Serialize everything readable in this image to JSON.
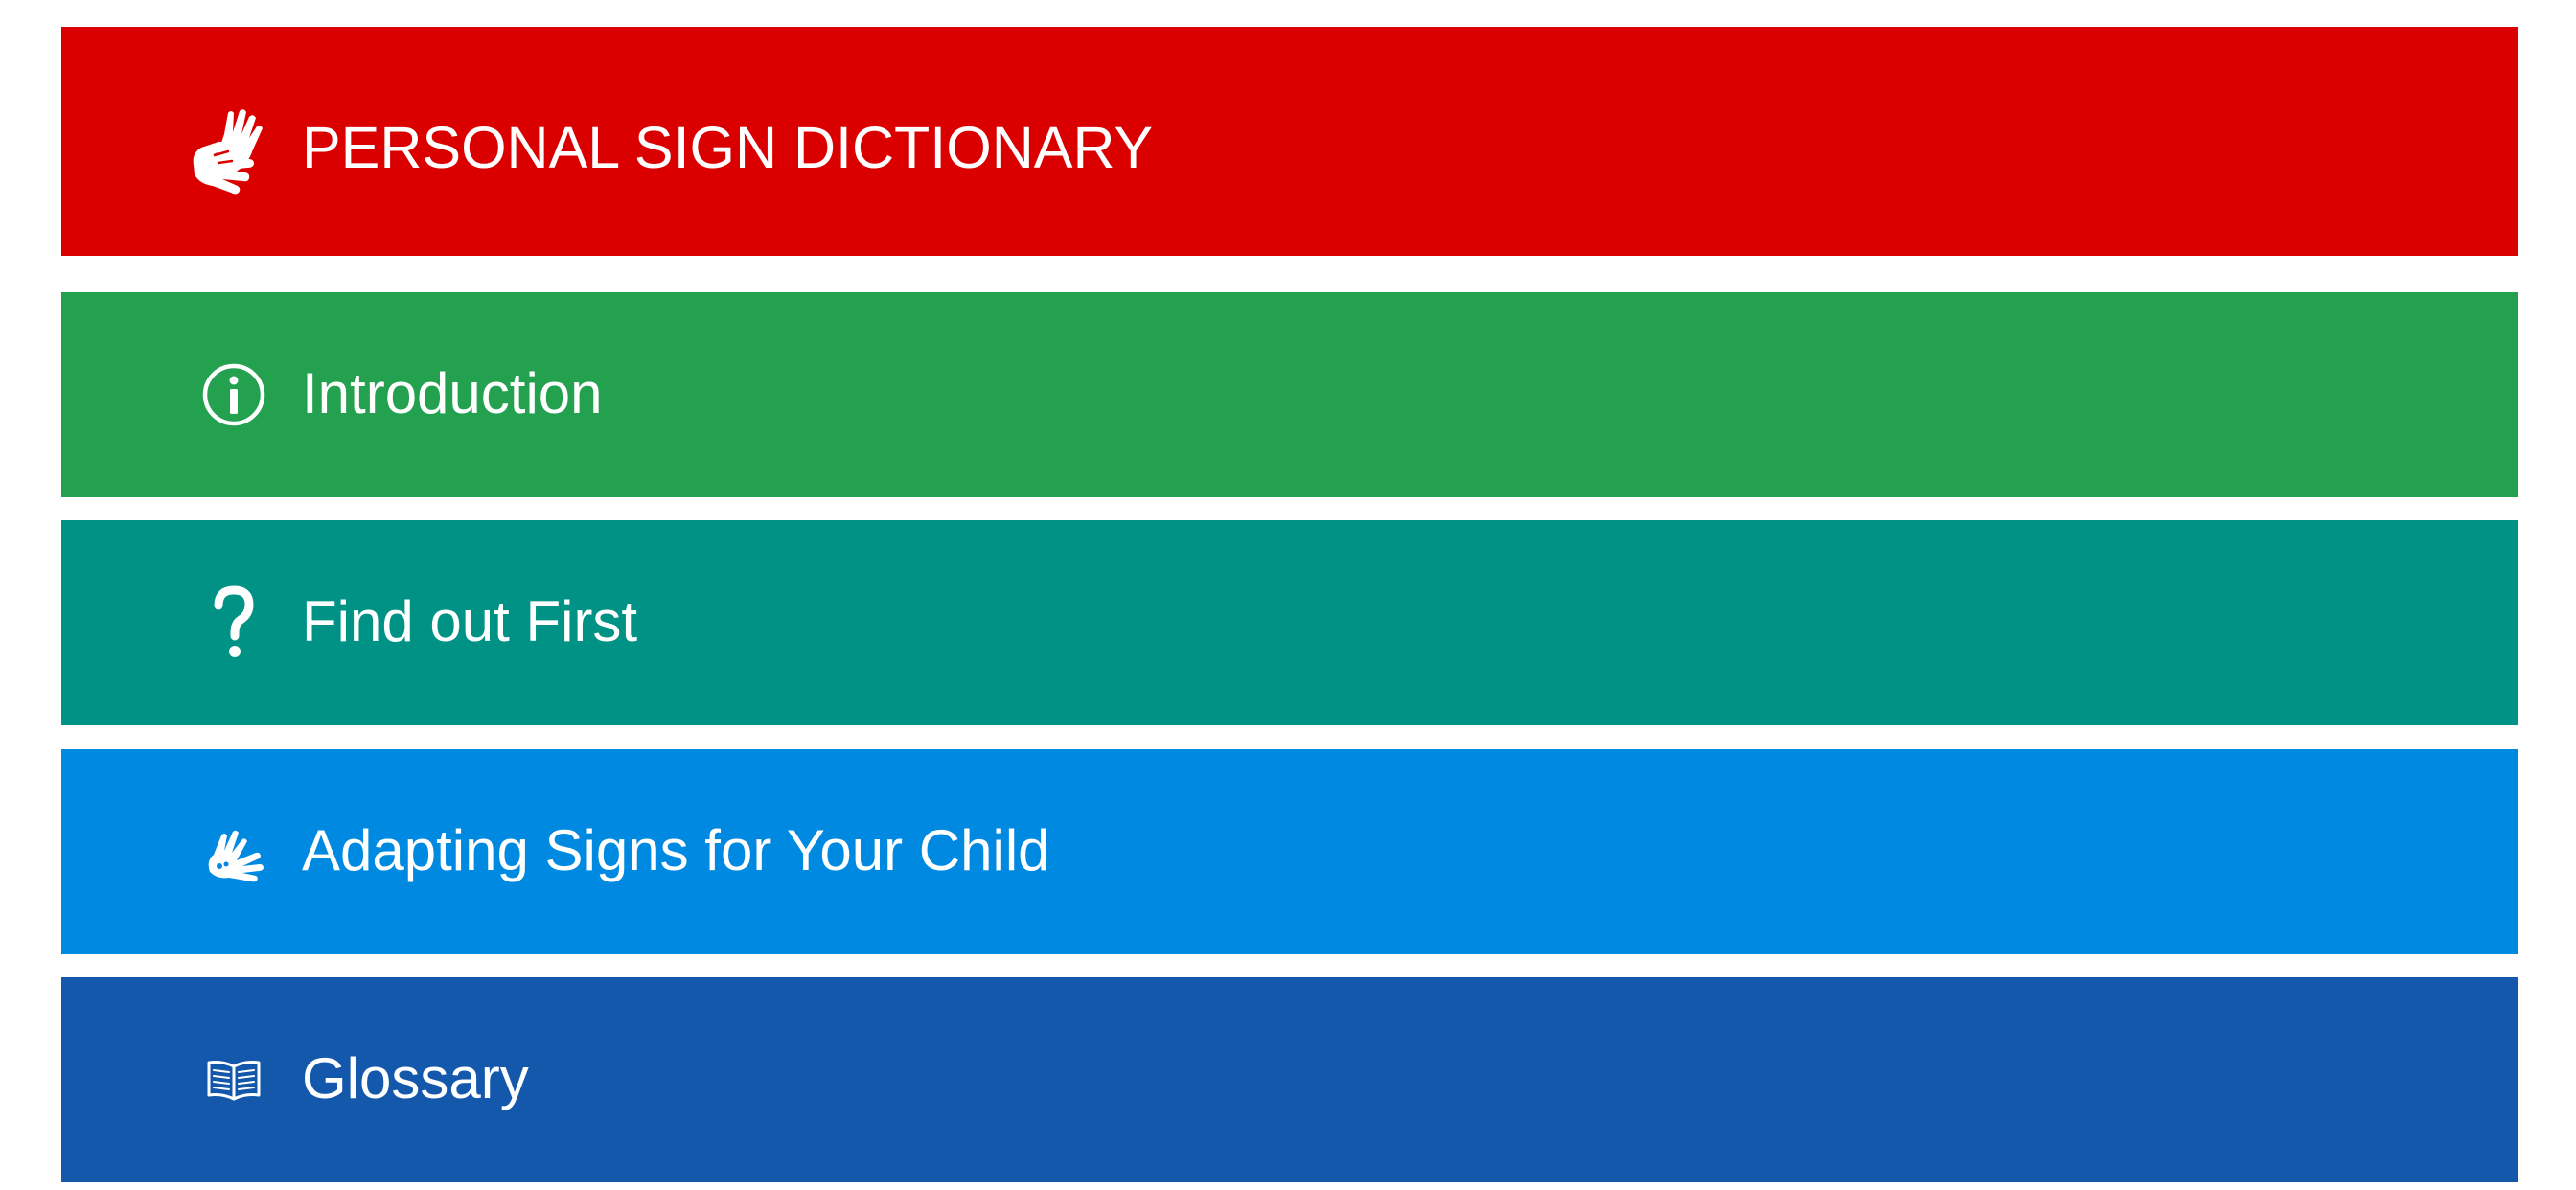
{
  "colors": {
    "header": "#db0000",
    "introduction": "#23a14e",
    "find_out_first": "#009285",
    "adapting_signs": "#0089e0",
    "glossary": "#1358ab"
  },
  "header": {
    "title": "PERSONAL SIGN DICTIONARY",
    "icon": "signing-hands-icon"
  },
  "menu": {
    "introduction": {
      "label": "Introduction",
      "icon": "info-icon"
    },
    "find_out_first": {
      "label": "Find out First",
      "icon": "question-mark-icon"
    },
    "adapting_signs": {
      "label": "Adapting Signs for Your Child",
      "icon": "adapting-hands-icon"
    },
    "glossary": {
      "label": "Glossary",
      "icon": "open-book-icon"
    }
  }
}
